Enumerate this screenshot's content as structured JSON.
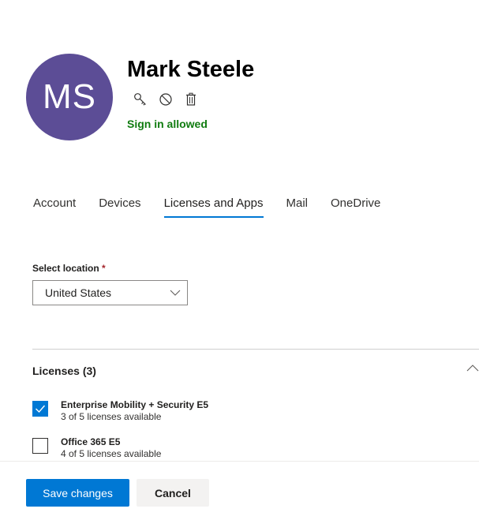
{
  "user": {
    "initials": "MS",
    "name": "Mark Steele",
    "sign_in_status": "Sign in allowed",
    "avatar_color": "#5c4d96",
    "status_color": "#107c10"
  },
  "actions": [
    {
      "icon": "key-icon"
    },
    {
      "icon": "block-icon"
    },
    {
      "icon": "trash-icon"
    }
  ],
  "tabs": [
    {
      "label": "Account",
      "active": false
    },
    {
      "label": "Devices",
      "active": false
    },
    {
      "label": "Licenses and Apps",
      "active": true
    },
    {
      "label": "Mail",
      "active": false
    },
    {
      "label": "OneDrive",
      "active": false
    }
  ],
  "location": {
    "label": "Select location",
    "required_mark": "*",
    "value": "United States"
  },
  "licenses": {
    "title": "Licenses (3)",
    "items": [
      {
        "name": "Enterprise Mobility + Security E5",
        "availability": "3 of 5 licenses available",
        "checked": true
      },
      {
        "name": "Office 365 E5",
        "availability": "4 of 5 licenses available",
        "checked": false
      }
    ]
  },
  "footer": {
    "save_label": "Save changes",
    "cancel_label": "Cancel"
  },
  "colors": {
    "accent": "#0078d4"
  }
}
